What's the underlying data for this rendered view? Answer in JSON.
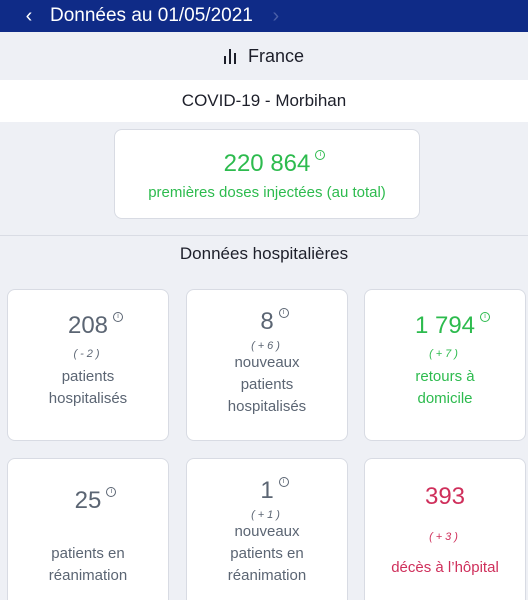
{
  "topbar": {
    "title": "Données au 01/05/2021",
    "prev_icon": "chevron-left-icon",
    "next_icon": "chevron-right-icon"
  },
  "country": {
    "icon": "bar-chart-icon",
    "label": "France"
  },
  "region": {
    "title": "COVID-19 - Morbihan"
  },
  "vaccination": {
    "value": "220 864",
    "label": "premières doses injectées (au total)"
  },
  "hospital": {
    "title": "Données hospitalières",
    "cards": [
      {
        "value": "208",
        "delta": "(-2)",
        "label_lines": [
          "patients",
          "hospitalisés"
        ]
      },
      {
        "value": "8",
        "delta": "(+6)",
        "label_lines": [
          "nouveaux",
          "patients",
          "hospitalisés"
        ]
      },
      {
        "value": "1 794",
        "delta": "(+7)",
        "label_lines": [
          "retours à",
          "domicile"
        ]
      },
      {
        "value": "25",
        "delta": "",
        "label_lines": [
          "patients en",
          "réanimation"
        ]
      },
      {
        "value": "1",
        "delta": "(+1)",
        "label_lines": [
          "nouveaux",
          "patients en",
          "réanimation"
        ]
      },
      {
        "value": "393",
        "delta": "(+3)",
        "label_lines": [
          "décès à l’hôpital"
        ]
      }
    ]
  },
  "colors": {
    "header_bg": "#0f2b87",
    "green": "#2dbb4e",
    "red": "#cf2f5b",
    "gray": "#5b6573"
  },
  "info_icon_glyph": "i"
}
